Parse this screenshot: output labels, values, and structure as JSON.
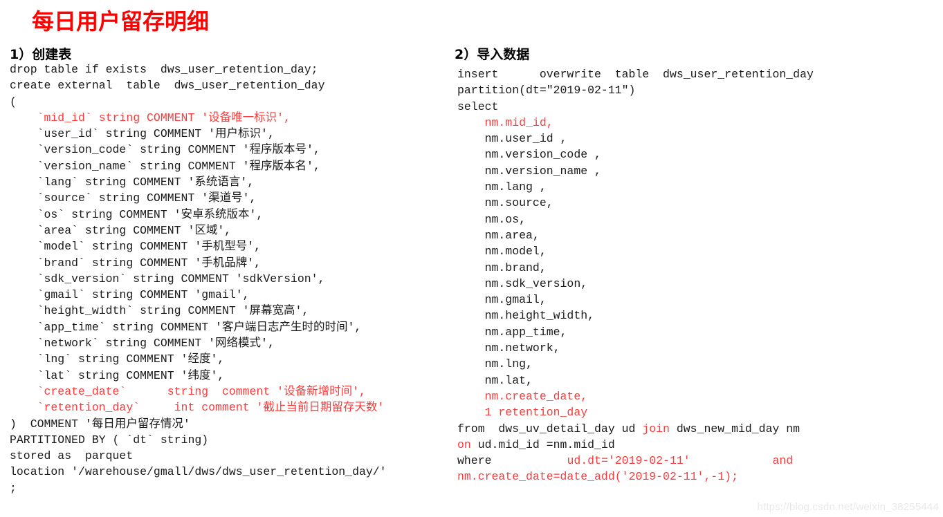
{
  "page": {
    "title": "每日用户留存明细",
    "title_color": "#ff0000",
    "background_color": "#ffffff",
    "code_red_color": "#fb3b3b",
    "code_black_color": "#1a1a1a"
  },
  "watermark": {
    "text": "https://blog.csdn.net/weixin_38255444"
  },
  "sections": {
    "create_table": {
      "heading": "1）创建表",
      "lines": [
        [
          {
            "t": "drop table if exists  dws_user_retention_day;",
            "c": "black"
          }
        ],
        [
          {
            "t": "create external  table  dws_user_retention_day",
            "c": "black"
          }
        ],
        [
          {
            "t": "(",
            "c": "black"
          }
        ],
        [
          {
            "t": "    `mid_id` string COMMENT '设备唯一标识',",
            "c": "red"
          }
        ],
        [
          {
            "t": "    `user_id` string COMMENT '用户标识',",
            "c": "black"
          }
        ],
        [
          {
            "t": "    `version_code` string COMMENT '程序版本号',",
            "c": "black"
          }
        ],
        [
          {
            "t": "    `version_name` string COMMENT '程序版本名',",
            "c": "black"
          }
        ],
        [
          {
            "t": "    `lang` string COMMENT '系统语言',",
            "c": "black"
          }
        ],
        [
          {
            "t": "    `source` string COMMENT '渠道号',",
            "c": "black"
          }
        ],
        [
          {
            "t": "    `os` string COMMENT '安卓系统版本',",
            "c": "black"
          }
        ],
        [
          {
            "t": "    `area` string COMMENT '区域',",
            "c": "black"
          }
        ],
        [
          {
            "t": "    `model` string COMMENT '手机型号',",
            "c": "black"
          }
        ],
        [
          {
            "t": "    `brand` string COMMENT '手机品牌',",
            "c": "black"
          }
        ],
        [
          {
            "t": "    `sdk_version` string COMMENT 'sdkVersion',",
            "c": "black"
          }
        ],
        [
          {
            "t": "    `gmail` string COMMENT 'gmail',",
            "c": "black"
          }
        ],
        [
          {
            "t": "    `height_width` string COMMENT '屏幕宽高',",
            "c": "black"
          }
        ],
        [
          {
            "t": "    `app_time` string COMMENT '客户端日志产生时的时间',",
            "c": "black"
          }
        ],
        [
          {
            "t": "    `network` string COMMENT '网络模式',",
            "c": "black"
          }
        ],
        [
          {
            "t": "    `lng` string COMMENT '经度',",
            "c": "black"
          }
        ],
        [
          {
            "t": "    `lat` string COMMENT '纬度',",
            "c": "black"
          }
        ],
        [
          {
            "t": "    `create_date`      string  comment '设备新增时间',",
            "c": "red"
          }
        ],
        [
          {
            "t": "    `retention_day`     int comment '截止当前日期留存天数'",
            "c": "red"
          }
        ],
        [
          {
            "t": ")  COMMENT '每日用户留存情况'",
            "c": "black"
          }
        ],
        [
          {
            "t": "PARTITIONED BY ( `dt` string)",
            "c": "black"
          }
        ],
        [
          {
            "t": "stored as  parquet",
            "c": "black"
          }
        ],
        [
          {
            "t": "location '/warehouse/gmall/dws/dws_user_retention_day/'",
            "c": "black"
          }
        ],
        [
          {
            "t": ";",
            "c": "black"
          }
        ]
      ]
    },
    "import_data": {
      "heading": "2）导入数据",
      "lines": [
        [
          {
            "t": "insert      overwrite  table  dws_user_retention_day",
            "c": "black"
          }
        ],
        [
          {
            "t": "partition(dt=\"2019-02-11\")",
            "c": "black"
          }
        ],
        [
          {
            "t": "select",
            "c": "black"
          }
        ],
        [
          {
            "t": "    nm.mid_id,",
            "c": "red"
          }
        ],
        [
          {
            "t": "    nm.user_id ,",
            "c": "black"
          }
        ],
        [
          {
            "t": "    nm.version_code ,",
            "c": "black"
          }
        ],
        [
          {
            "t": "    nm.version_name ,",
            "c": "black"
          }
        ],
        [
          {
            "t": "    nm.lang ,",
            "c": "black"
          }
        ],
        [
          {
            "t": "    nm.source,",
            "c": "black"
          }
        ],
        [
          {
            "t": "    nm.os,",
            "c": "black"
          }
        ],
        [
          {
            "t": "    nm.area,",
            "c": "black"
          }
        ],
        [
          {
            "t": "    nm.model,",
            "c": "black"
          }
        ],
        [
          {
            "t": "    nm.brand,",
            "c": "black"
          }
        ],
        [
          {
            "t": "    nm.sdk_version,",
            "c": "black"
          }
        ],
        [
          {
            "t": "    nm.gmail,",
            "c": "black"
          }
        ],
        [
          {
            "t": "    nm.height_width,",
            "c": "black"
          }
        ],
        [
          {
            "t": "    nm.app_time,",
            "c": "black"
          }
        ],
        [
          {
            "t": "    nm.network,",
            "c": "black"
          }
        ],
        [
          {
            "t": "    nm.lng,",
            "c": "black"
          }
        ],
        [
          {
            "t": "    nm.lat,",
            "c": "black"
          }
        ],
        [
          {
            "t": "    nm.create_date,",
            "c": "red"
          }
        ],
        [
          {
            "t": "    1 retention_day",
            "c": "red"
          }
        ],
        [
          {
            "t": "from  dws_uv_detail_day ud ",
            "c": "black"
          },
          {
            "t": "join",
            "c": "red"
          },
          {
            "t": " dws_new_mid_day nm",
            "c": "black"
          }
        ],
        [
          {
            "t": "on",
            "c": "red"
          },
          {
            "t": " ud.mid_id =nm.mid_id",
            "c": "black"
          }
        ],
        [
          {
            "t": "where           ",
            "c": "black"
          },
          {
            "t": "ud.dt='2019-02-11'",
            "c": "red"
          },
          {
            "t": "            ",
            "c": "black"
          },
          {
            "t": "and",
            "c": "red"
          }
        ],
        [
          {
            "t": "nm.create_date=date_add('2019-02-11',-1);",
            "c": "red"
          }
        ]
      ]
    }
  }
}
